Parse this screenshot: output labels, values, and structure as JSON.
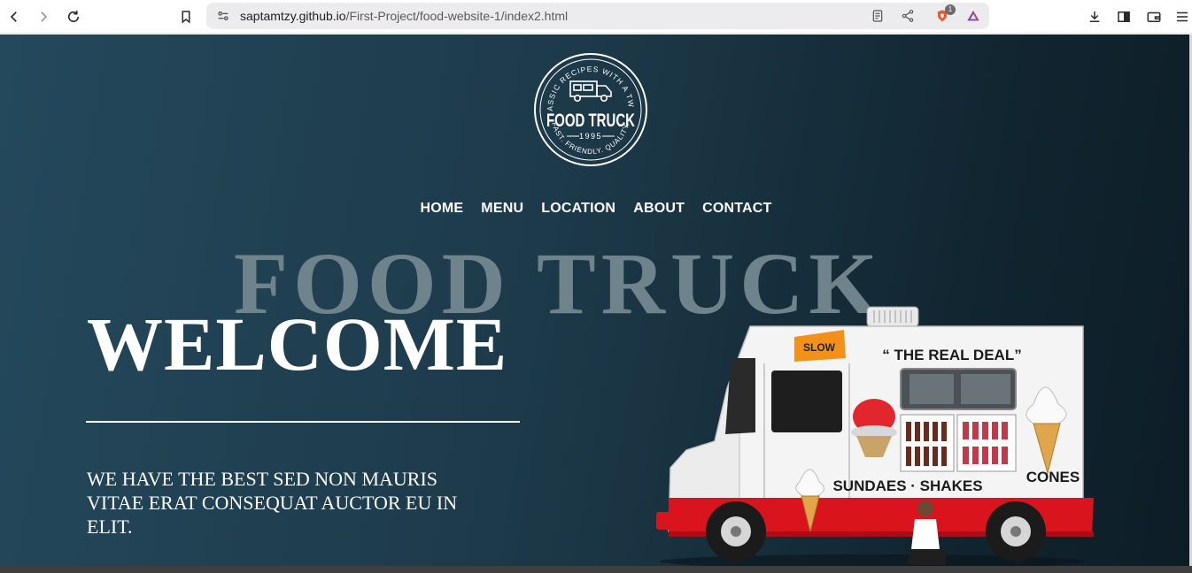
{
  "browser": {
    "url_host": "saptamtzy.github.io",
    "url_path": "/First-Project/food-website-1/index2.html",
    "brave_badge_count": "1"
  },
  "logo": {
    "ring_text": "CLASSIC RECIPES WITH A TWIST",
    "name": "FOOD TRUCK",
    "year": "1995",
    "bottom_text": "FAST. FRIENDLY. QUALITY."
  },
  "nav": {
    "items": [
      "HOME",
      "MENU",
      "LOCATION",
      "ABOUT",
      "CONTACT"
    ]
  },
  "hero": {
    "background_title": "FOOD TRUCK",
    "heading": "WELCOME",
    "tagline": "WE HAVE THE BEST SED NON MAURIS VITAE ERAT CONSEQUAT AUCTOR EU IN ELIT."
  },
  "truck_signs": {
    "slogan": "“ THE REAL DEAL”",
    "side": "SUNDAES · SHAKES",
    "cones": "CONES",
    "warning": "SLOW"
  },
  "colors": {
    "accent": "#ffffff",
    "bg_dark": "#112530",
    "truck_red": "#d9141c"
  }
}
